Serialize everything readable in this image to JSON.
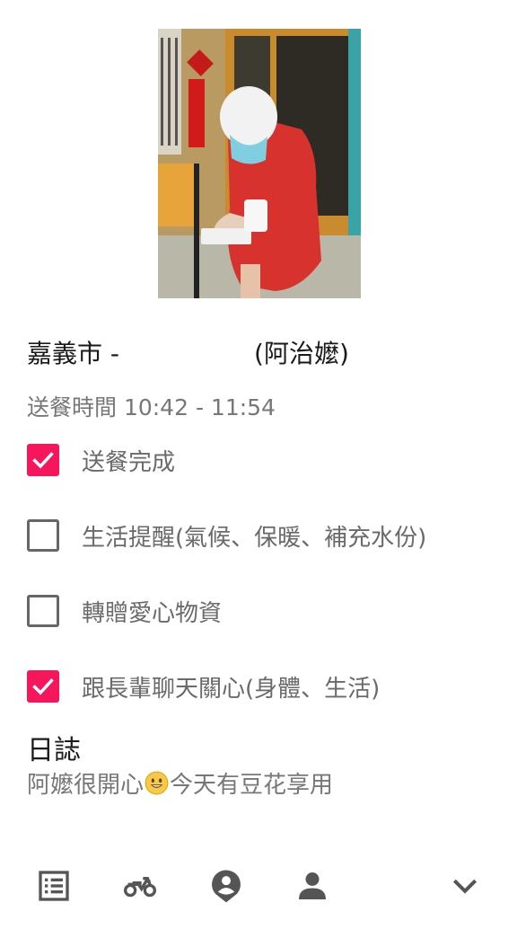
{
  "record": {
    "title_left": "嘉義市 -",
    "title_right": "(阿治嬤)",
    "delivery_time": "送餐時間 10:42 - 11:54"
  },
  "checklist": [
    {
      "label": "送餐完成",
      "checked": true
    },
    {
      "label": "生活提醒(氣候、保暖、補充水份)",
      "checked": false
    },
    {
      "label": "轉贈愛心物資",
      "checked": false
    },
    {
      "label": "跟長輩聊天關心(身體、生活)",
      "checked": true
    }
  ],
  "log": {
    "title": "日誌",
    "text_before": "阿嬤很開心",
    "text_after": "今天有豆花享用"
  },
  "nav": {
    "items": [
      "list-icon",
      "motorcycle-icon",
      "location-person-icon",
      "person-icon",
      "chevron-down-icon"
    ]
  },
  "colors": {
    "accent": "#f5165b",
    "muted_text": "#777777",
    "icon": "#555555"
  }
}
